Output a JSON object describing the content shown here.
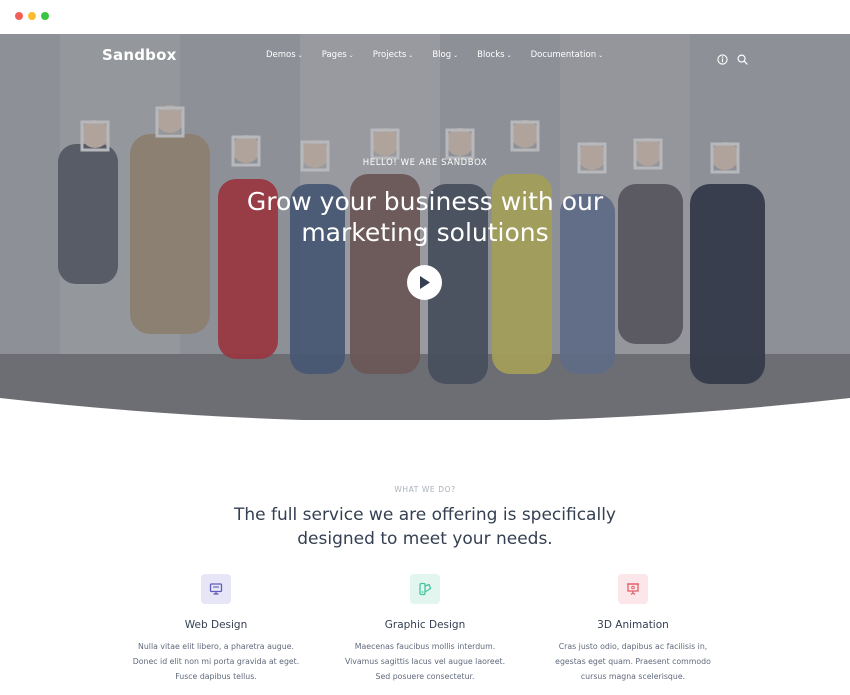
{
  "brand": {
    "logo_text": "Sandbox"
  },
  "nav": {
    "items": [
      "Demos",
      "Pages",
      "Projects",
      "Blog",
      "Blocks",
      "Documentation"
    ],
    "icons": [
      "info-icon",
      "search-icon"
    ]
  },
  "hero": {
    "eyebrow": "HELLO! WE ARE SANDBOX",
    "headline": "Grow your business with our marketing solutions",
    "play_icon": "play-icon"
  },
  "services_section": {
    "eyebrow": "WHAT WE DO?",
    "title": "The full service we are offering is specifically designed to meet your needs.",
    "items": [
      {
        "icon": "monitor-icon",
        "icon_color": "#605dba",
        "icon_bg": "#e7e6f7",
        "title": "Web Design",
        "text": "Nulla vitae elit libero, a pharetra augue. Donec id elit non mi porta gravida at eget. Fusce dapibus tellus."
      },
      {
        "icon": "palette-icon",
        "icon_color": "#45c4a0",
        "icon_bg": "#e3f5ef",
        "title": "Graphic Design",
        "text": "Maecenas faucibus mollis interdum. Vivamus sagittis lacus vel augue laoreet. Sed posuere consectetur."
      },
      {
        "icon": "presentation-icon",
        "icon_color": "#e2626b",
        "icon_bg": "#fbe7e9",
        "title": "3D Animation",
        "text": "Cras justo odio, dapibus ac facilisis in, egestas eget quam. Praesent commodo cursus magna scelerisque."
      }
    ]
  }
}
